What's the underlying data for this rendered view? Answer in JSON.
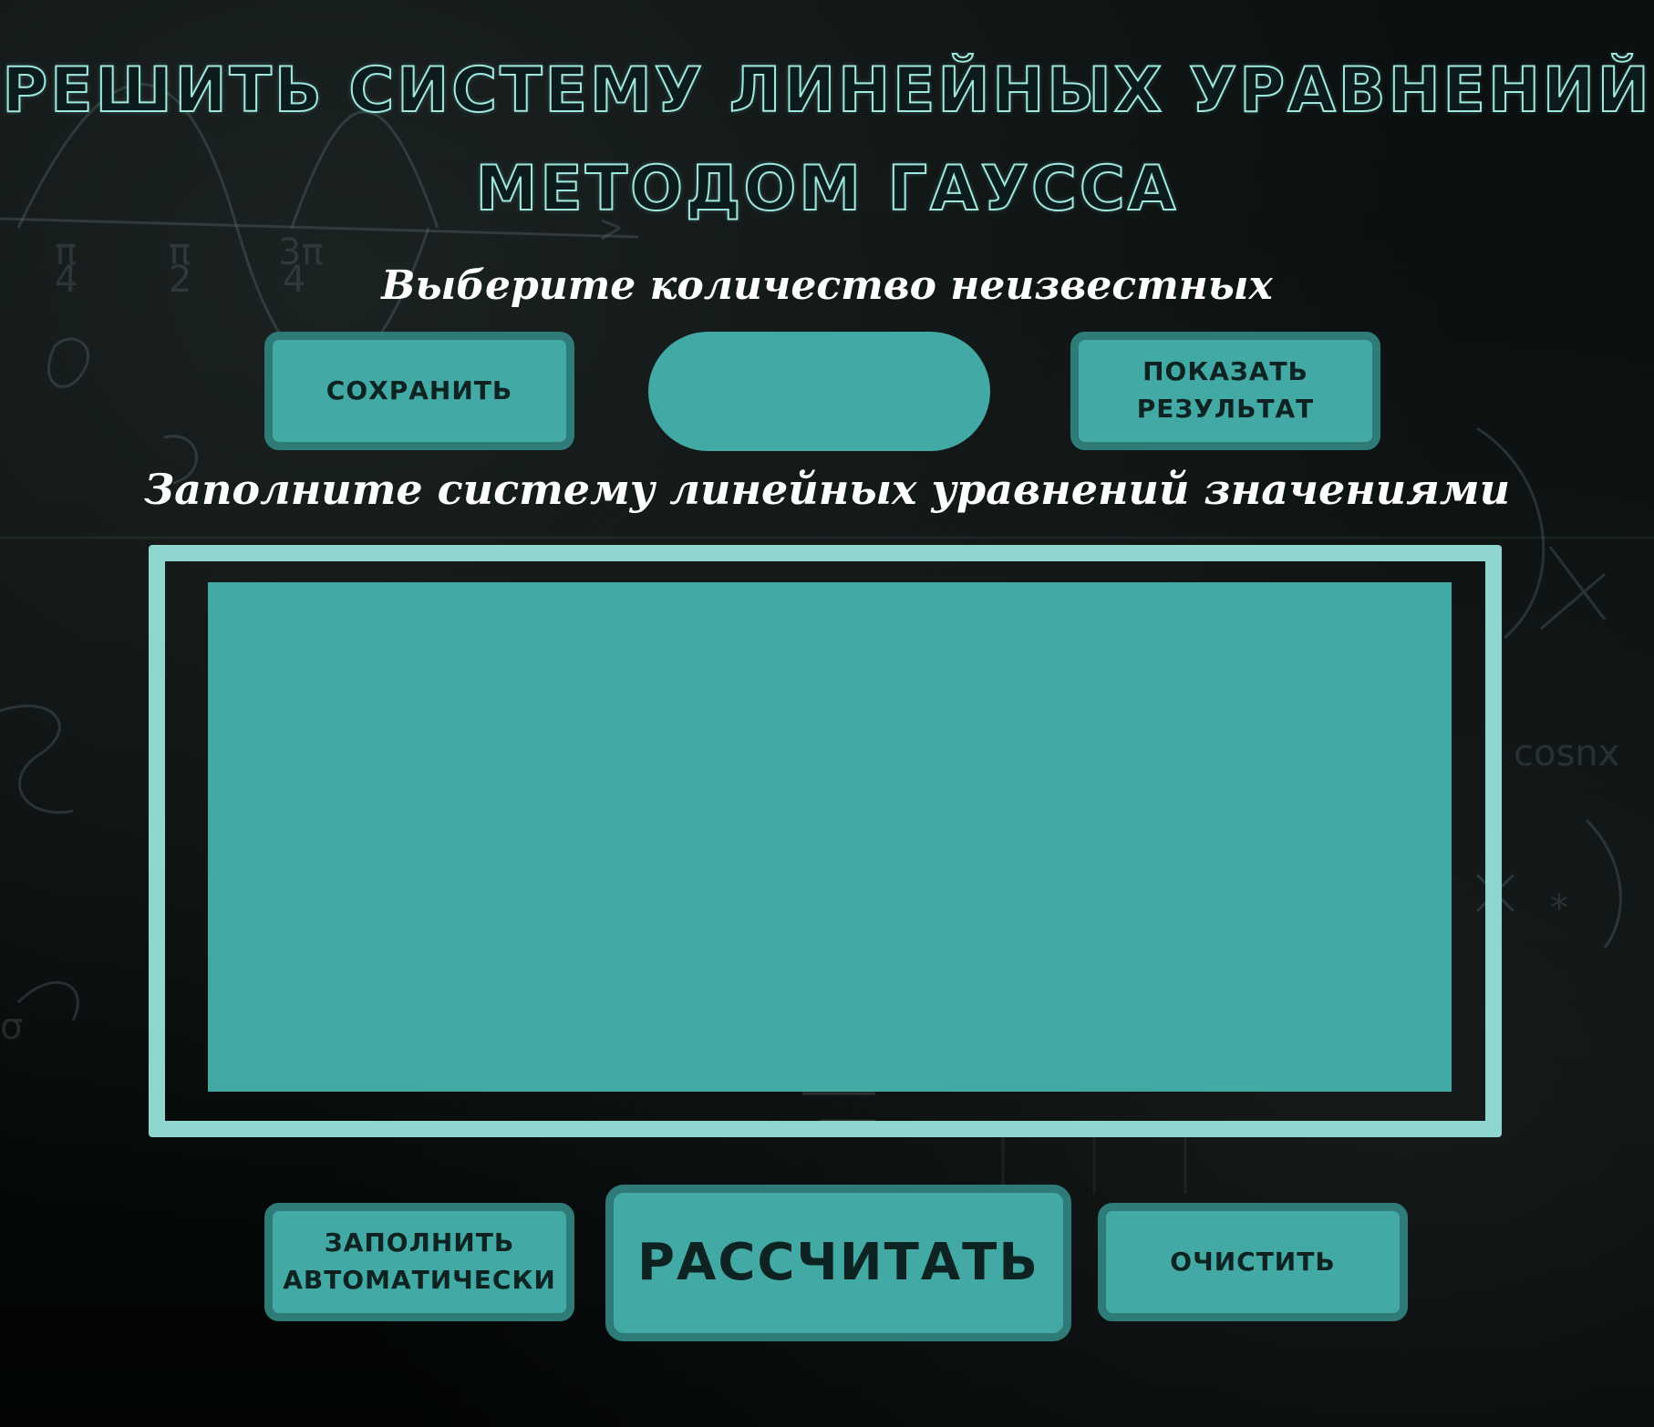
{
  "title": {
    "line1": "РЕШИТЬ СИСТЕМУ ЛИНЕЙНЫХ УРАВНЕНИЙ",
    "line2": "МЕТОДОМ ГАУССА"
  },
  "unknowns": {
    "label": "Выберите количество неизвестных",
    "value": "",
    "save_label": "СОХРАНИТЬ",
    "show_label_line1": "ПОКАЗАТЬ",
    "show_label_line2": "РЕЗУЛЬТАТ"
  },
  "system": {
    "label": "Заполните систему линейных уравнений значениями"
  },
  "actions": {
    "auto_fill_line1": "ЗАПОЛНИТЬ",
    "auto_fill_line2": "АВТОМАТИЧЕСКИ",
    "calculate_label": "РАССЧИТАТЬ",
    "clear_label": "ОЧИСТИТЬ"
  },
  "colors": {
    "accent": "#43a9a5",
    "accent_border": "#2f7b77",
    "frame": "#8fd6cf",
    "title_outline": "#9fe8e0",
    "background": "#060909"
  }
}
